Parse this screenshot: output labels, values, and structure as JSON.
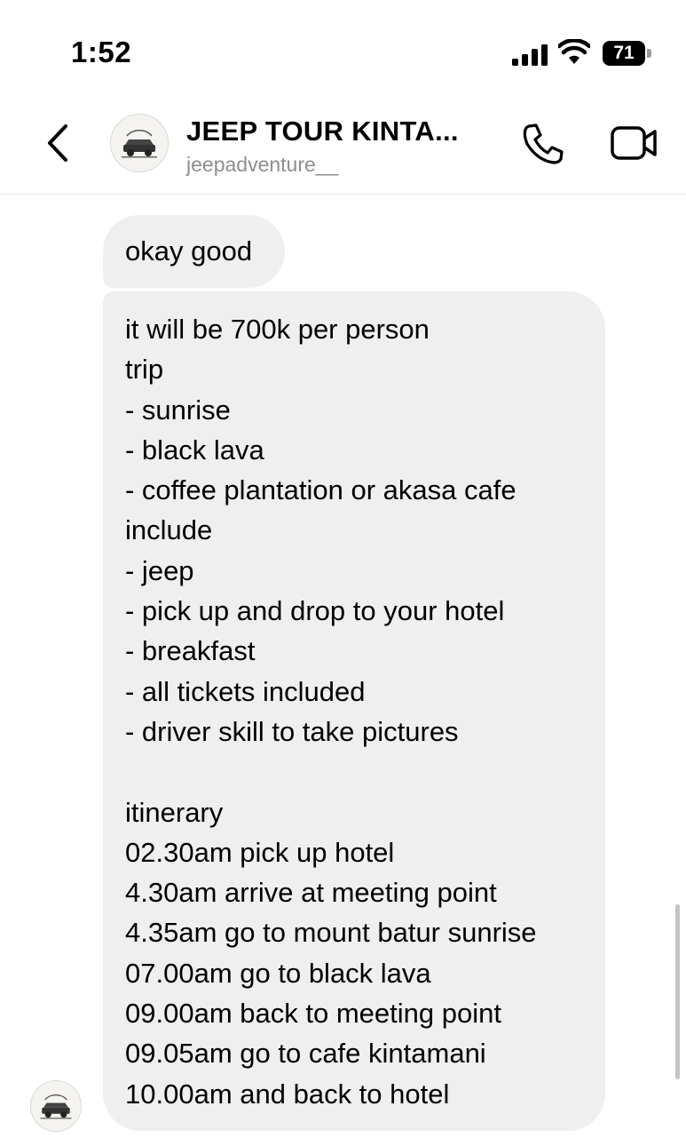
{
  "status_bar": {
    "time": "1:52",
    "battery": "71"
  },
  "header": {
    "contact_name": "JEEP TOUR KINTA...",
    "contact_handle": "jeepadventure__",
    "back_icon": "chevron-left-icon",
    "call_icon": "phone-icon",
    "video_icon": "video-camera-icon"
  },
  "messages": [
    {
      "text": "okay good"
    },
    {
      "lines": [
        "it will be 700k per person",
        "trip",
        "- sunrise",
        "- black lava",
        "- coffee plantation or akasa cafe",
        "include",
        "- jeep",
        "- pick up and drop to your hotel",
        "- breakfast",
        "- all tickets included",
        "- driver skill to take pictures",
        "",
        "itinerary",
        "02.30am pick up hotel",
        "4.30am arrive at meeting point",
        "4.35am go to mount batur sunrise",
        "07.00am go to black lava",
        "09.00am back to meeting point",
        "09.05am go to cafe kintamani",
        "10.00am and back to hotel"
      ]
    }
  ],
  "colors": {
    "bubble_bg": "#efefef",
    "handle_text": "#8e8e8e",
    "divider": "#e6e6e6"
  }
}
